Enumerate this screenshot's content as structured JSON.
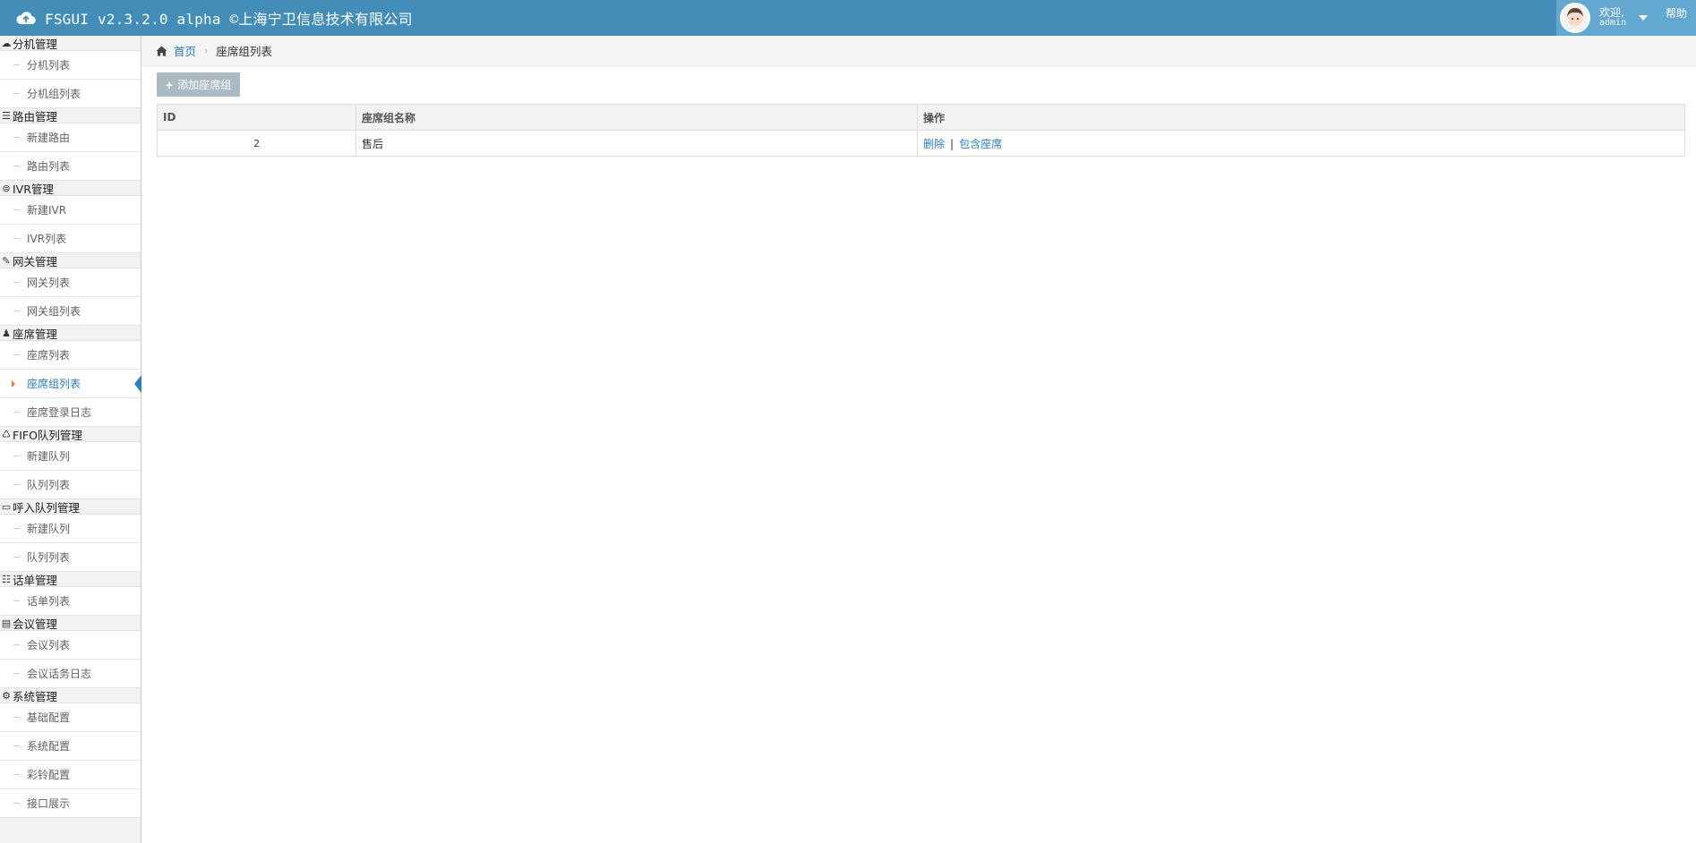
{
  "navbar": {
    "title": "FSGUI v2.3.2.0 alpha ©上海宁卫信息技术有限公司",
    "welcome": "欢迎,",
    "username": "admin",
    "help": "帮助"
  },
  "sidebar": {
    "groups": [
      {
        "label": "分机管理",
        "icon": "cloud-icon",
        "items": [
          "分机列表",
          "分机组列表"
        ]
      },
      {
        "label": "路由管理",
        "icon": "list-icon",
        "items": [
          "新建路由",
          "路由列表"
        ]
      },
      {
        "label": "IVR管理",
        "icon": "globe-icon",
        "items": [
          "新建IVR",
          "IVR列表"
        ]
      },
      {
        "label": "网关管理",
        "icon": "plug-icon",
        "items": [
          "网关列表",
          "网关组列表"
        ]
      },
      {
        "label": "座席管理",
        "icon": "user-icon",
        "items": [
          "座席列表",
          "座席组列表",
          "座席登录日志"
        ]
      },
      {
        "label": "FIFO队列管理",
        "icon": "recycle-icon",
        "items": [
          "新建队列",
          "队列列表"
        ]
      },
      {
        "label": "呼入队列管理",
        "icon": "cc-icon",
        "items": [
          "新建队列",
          "队列列表"
        ]
      },
      {
        "label": "话单管理",
        "icon": "list-alt-icon",
        "items": [
          "话单列表"
        ]
      },
      {
        "label": "会议管理",
        "icon": "building-icon",
        "items": [
          "会议列表",
          "会议话务日志"
        ]
      },
      {
        "label": "系统管理",
        "icon": "gear-icon",
        "items": [
          "基础配置",
          "系统配置",
          "彩铃配置",
          "接口展示"
        ]
      }
    ],
    "active_item": "座席组列表"
  },
  "breadcrumb": {
    "home": "首页",
    "current": "座席组列表"
  },
  "toolbar": {
    "add_label": "添加座席组"
  },
  "table": {
    "headers": [
      "ID",
      "座席组名称",
      "操作"
    ],
    "rows": [
      {
        "id": "2",
        "name": "售后",
        "actions": [
          "删除",
          "包含座席"
        ]
      }
    ]
  },
  "colors": {
    "navbar": "#438eb9",
    "user_area": "#62a8d1",
    "link": "#2b7dbc",
    "button": "#abbac3"
  }
}
